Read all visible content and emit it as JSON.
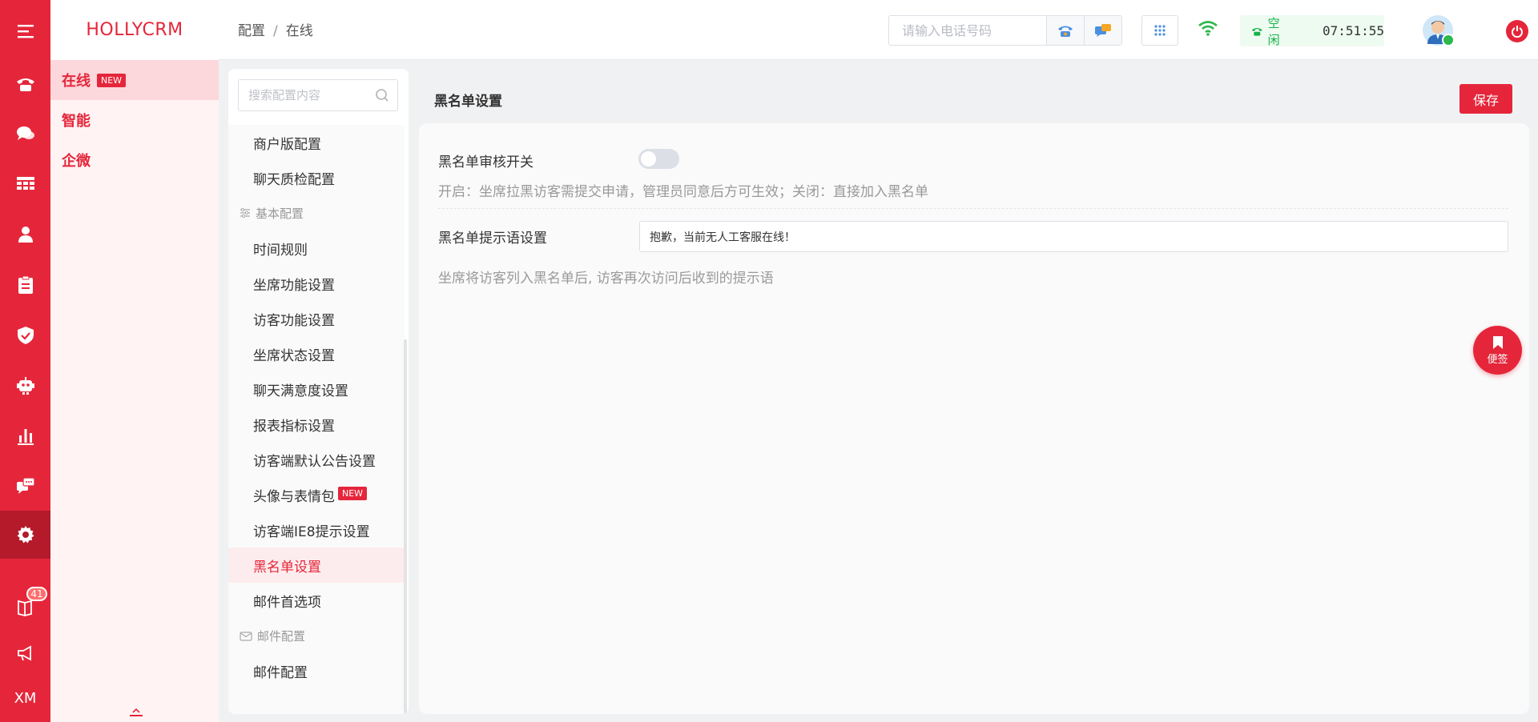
{
  "colors": {
    "brand": "#e5263a",
    "brand_dark": "#b51a2b",
    "status_green": "#18b14a"
  },
  "rail": {
    "items": [
      {
        "icon": "menu-icon"
      },
      {
        "icon": "phone-icon"
      },
      {
        "icon": "chat-icon"
      },
      {
        "icon": "table-icon"
      },
      {
        "icon": "user-icon"
      },
      {
        "icon": "clipboard-icon"
      },
      {
        "icon": "shield-icon"
      },
      {
        "icon": "robot-icon"
      },
      {
        "icon": "bar-chart-icon"
      },
      {
        "icon": "messages-icon"
      },
      {
        "icon": "settings-icon",
        "active": true
      },
      {
        "icon": "book-icon",
        "badge": "41"
      },
      {
        "icon": "megaphone-icon"
      },
      {
        "icon": "xm-text",
        "text": "XM"
      }
    ]
  },
  "submenu": {
    "brand": "HOLLYCRM",
    "items": [
      {
        "label": "在线",
        "badge": "NEW",
        "active": true
      },
      {
        "label": "智能"
      },
      {
        "label": "企微"
      }
    ]
  },
  "header": {
    "breadcrumb": [
      "配置",
      "在线"
    ],
    "breadcrumb_sep": "/",
    "phone_placeholder": "请输入电话号码",
    "status_label": "空闲",
    "time": "07:51:55"
  },
  "config_sidebar": {
    "search_placeholder": "搜索配置内容",
    "items": [
      {
        "type": "item",
        "label": "商户版配置"
      },
      {
        "type": "item",
        "label": "聊天质检配置"
      },
      {
        "type": "group",
        "label": "基本配置",
        "icon": "sliders-icon"
      },
      {
        "type": "item",
        "label": "时间规则"
      },
      {
        "type": "item",
        "label": "坐席功能设置"
      },
      {
        "type": "item",
        "label": "访客功能设置"
      },
      {
        "type": "item",
        "label": "坐席状态设置"
      },
      {
        "type": "item",
        "label": "聊天满意度设置"
      },
      {
        "type": "item",
        "label": "报表指标设置"
      },
      {
        "type": "item",
        "label": "访客端默认公告设置"
      },
      {
        "type": "item",
        "label": "头像与表情包",
        "badge": "NEW"
      },
      {
        "type": "item",
        "label": "访客端IE8提示设置"
      },
      {
        "type": "item",
        "label": "黑名单设置",
        "active": true
      },
      {
        "type": "item",
        "label": "邮件首选项"
      },
      {
        "type": "group",
        "label": "邮件配置",
        "icon": "mail-icon"
      },
      {
        "type": "item",
        "label": "邮件配置"
      }
    ]
  },
  "main": {
    "title": "黑名单设置",
    "save_label": "保存",
    "review_switch": {
      "label": "黑名单审核开关",
      "enabled": false,
      "description": "开启：坐席拉黑访客需提交申请，管理员同意后方可生效；关闭：直接加入黑名单"
    },
    "tip_setting": {
      "label": "黑名单提示语设置",
      "value": "抱歉，当前无人工客服在线！",
      "description": "坐席将访客列入黑名单后, 访客再次访问后收到的提示语"
    }
  },
  "sticky_note": {
    "label": "便签"
  }
}
